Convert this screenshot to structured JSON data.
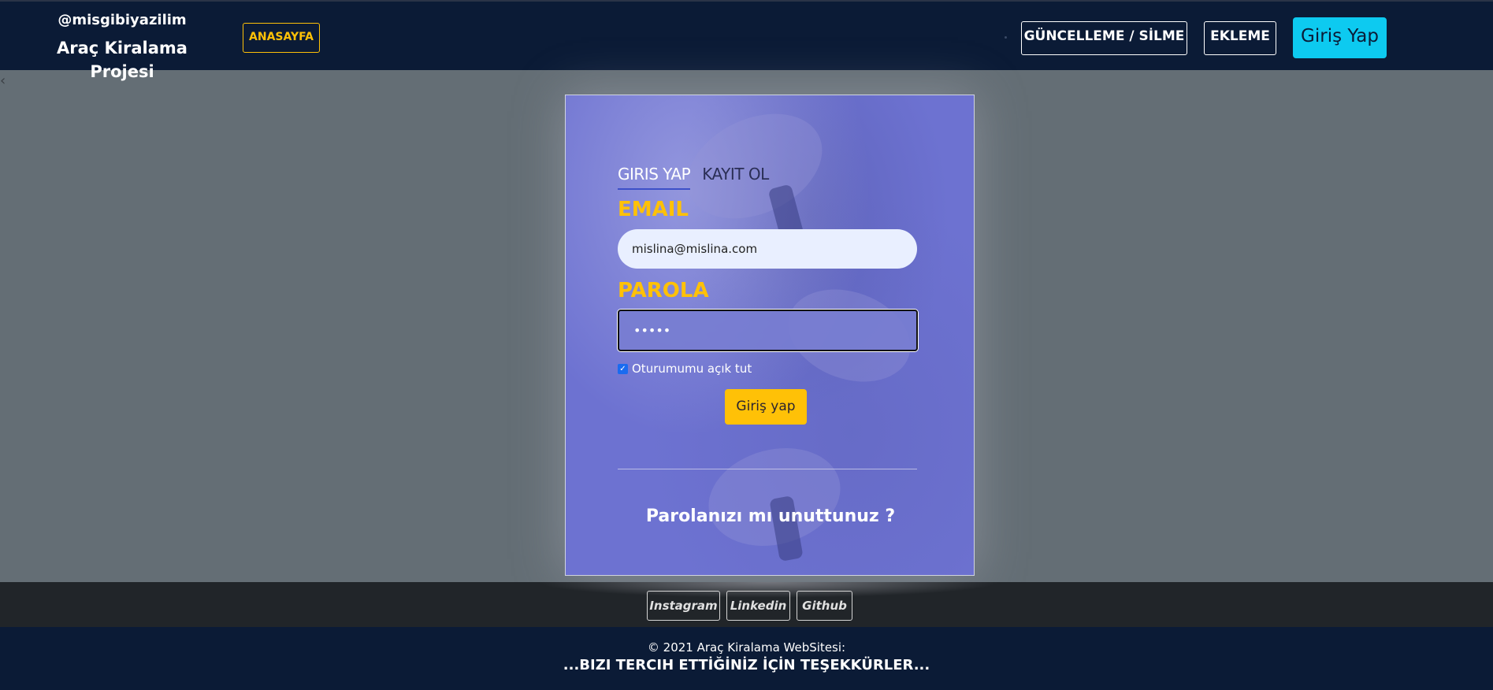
{
  "header": {
    "handle": "@misgibiyazilim",
    "project_title": "Araç Kiralama Projesi",
    "home_label": "ANASAYFA",
    "update_delete_label": "GÜNCELLEME / SİLME",
    "add_label": "EKLEME",
    "login_label": "Giriş Yap"
  },
  "login_form": {
    "tabs": [
      {
        "label": "GIRIS YAP",
        "active": true
      },
      {
        "label": "KAYIT OL",
        "active": false
      }
    ],
    "email_label": "EMAIL",
    "email_value": "mislina@mislina.com",
    "password_label": "PAROLA",
    "password_value": "•••••",
    "remember_label": "Oturumumu açık tut",
    "remember_checked": true,
    "submit_label": "Giriş yap",
    "forgot_label": "Parolanızı mı unuttunuz ?"
  },
  "social": {
    "instagram": "Instagram",
    "linkedin": "Linkedin",
    "github": "Github"
  },
  "footer": {
    "copyright": "© 2021 Araç Kiralama WebSitesi:",
    "thanks": "...BIZI TERCIH ETTİĞİNİZ İÇİN TEŞEKKÜRLER..."
  },
  "colors": {
    "navy": "#0b1b36",
    "accent_yellow": "#ffc107",
    "accent_cyan": "#0dcaf0",
    "card_purple": "#6d72d1"
  }
}
